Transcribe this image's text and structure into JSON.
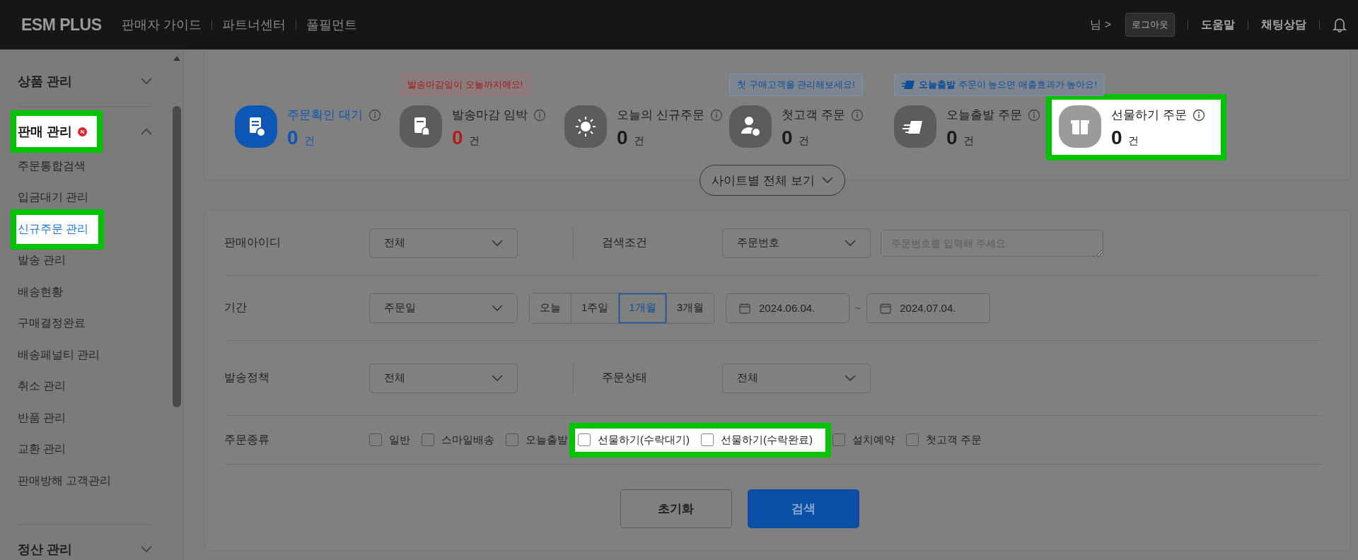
{
  "header": {
    "logo": "ESM PLUS",
    "links": [
      "판매자 가이드",
      "파트너센터",
      "풀필먼트"
    ],
    "user": "님 >",
    "logout": "로그아웃",
    "help": "도움말",
    "chat": "채팅상담"
  },
  "sidebar": {
    "sections": [
      {
        "label": "상품 관리",
        "expanded": false,
        "highlighted": false
      },
      {
        "label": "판매 관리",
        "expanded": true,
        "highlighted": true,
        "badge": "N",
        "children": [
          {
            "label": "주문통합검색",
            "selected": false,
            "highlighted": false
          },
          {
            "label": "입금대기 관리",
            "selected": false,
            "highlighted": false
          },
          {
            "label": "신규주문 관리",
            "selected": true,
            "highlighted": true
          },
          {
            "label": "발송 관리",
            "selected": false,
            "highlighted": false
          },
          {
            "label": "배송현황",
            "selected": false,
            "highlighted": false
          },
          {
            "label": "구매결정완료",
            "selected": false,
            "highlighted": false
          },
          {
            "label": "배송페널티 관리",
            "selected": false,
            "highlighted": false
          },
          {
            "label": "취소 관리",
            "selected": false,
            "highlighted": false
          },
          {
            "label": "반품 관리",
            "selected": false,
            "highlighted": false
          },
          {
            "label": "교환 관리",
            "selected": false,
            "highlighted": false
          },
          {
            "label": "판매방해 고객관리",
            "selected": false,
            "highlighted": false
          }
        ]
      },
      {
        "label": "정산 관리",
        "expanded": false,
        "highlighted": false
      }
    ]
  },
  "stats": {
    "cards": [
      {
        "label": "주문확인 대기",
        "count": "0",
        "unit": "건",
        "kind": "pending",
        "highlighted": false
      },
      {
        "label": "발송마감 임박",
        "count": "0",
        "unit": "건",
        "kind": "urgent",
        "highlighted": false,
        "tooltip": {
          "kind": "warning",
          "text": "발송마감일이 오늘까지에요!"
        }
      },
      {
        "label": "오늘의 신규주문",
        "count": "0",
        "unit": "건",
        "kind": "plain",
        "highlighted": false
      },
      {
        "label": "첫고객 주문",
        "count": "0",
        "unit": "건",
        "kind": "plain",
        "highlighted": false,
        "tooltip": {
          "kind": "info",
          "text": "첫 구매고객을 관리해보세요!"
        }
      },
      {
        "label": "오늘출발 주문",
        "count": "0",
        "unit": "건",
        "kind": "plain",
        "highlighted": false,
        "tooltip": {
          "kind": "promo",
          "text": "**오늘출발** 주문이 높으면 매출효과가 높아요!"
        }
      },
      {
        "label": "선물하기 주문",
        "count": "0",
        "unit": "건",
        "kind": "plain",
        "highlighted": true
      }
    ],
    "site_toggle": "사이트별 전체 보기"
  },
  "search_form": {
    "rows": [
      {
        "kind": "pair",
        "label": "판매아이디",
        "select": "전체",
        "label_2": "검색조건",
        "select_2": "주문번호",
        "placeholder": "주문번호를 입력해 주세요."
      },
      {
        "kind": "period",
        "label": "기간",
        "select": "주문일",
        "ranges": [
          {
            "label": "오늘",
            "selected": false
          },
          {
            "label": "1주일",
            "selected": false
          },
          {
            "label": "1개월",
            "selected": true
          },
          {
            "label": "3개월",
            "selected": false
          }
        ],
        "date_from": "2024.06.04.",
        "separator": "~",
        "date_to": "2024.07.04."
      },
      {
        "kind": "pair",
        "label": "발송정책",
        "select": "전체",
        "label_2": "주문상태",
        "select_2": "전체"
      },
      {
        "kind": "checks",
        "label": "주문종류",
        "options": [
          {
            "label": "일반",
            "checked": false,
            "highlighted": false
          },
          {
            "label": "스마일배송",
            "checked": false,
            "highlighted": false
          },
          {
            "label": "오늘출발",
            "checked": false,
            "highlighted": false
          },
          {
            "label": "선물하기(수락대기)",
            "checked": false,
            "highlighted": true
          },
          {
            "label": "선물하기(수락완료)",
            "checked": false,
            "highlighted": true
          },
          {
            "label": "설치예약",
            "checked": false,
            "highlighted": false
          },
          {
            "label": "첫고객 주문",
            "checked": false,
            "highlighted": false
          }
        ]
      }
    ],
    "buttons": [
      {
        "label": "초기화",
        "kind": "secondary"
      },
      {
        "label": "검색",
        "kind": "primary"
      }
    ]
  }
}
